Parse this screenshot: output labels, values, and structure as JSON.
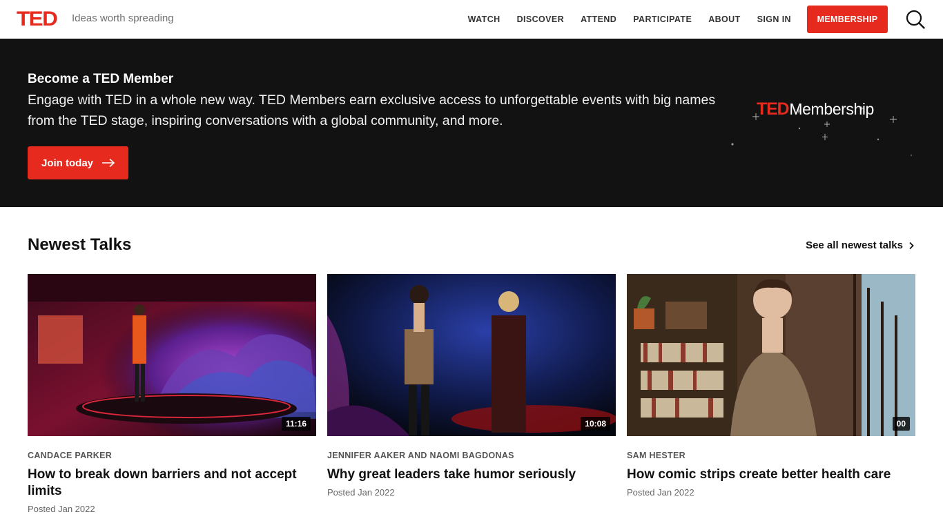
{
  "header": {
    "logo": "TED",
    "tagline": "Ideas worth spreading",
    "nav": [
      "WATCH",
      "DISCOVER",
      "ATTEND",
      "PARTICIPATE",
      "ABOUT",
      "SIGN IN"
    ],
    "membership_label": "MEMBERSHIP",
    "search_icon": "search-icon"
  },
  "banner": {
    "title": "Become a TED Member",
    "text": "Engage with TED in a whole new way. TED Members earn exclusive access to unforgettable events with big names from the TED stage, inspiring conversations with a global community, and more.",
    "join_label": "Join today",
    "logo_ted": "TED",
    "logo_word": "Membership"
  },
  "newest": {
    "title": "Newest Talks",
    "see_all": "See all newest talks",
    "talks": [
      {
        "speaker": "CANDACE PARKER",
        "title": "How to break down barriers and not accept limits",
        "posted": "Posted Jan 2022",
        "duration": "11:16"
      },
      {
        "speaker": "JENNIFER AAKER AND NAOMI BAGDONAS",
        "title": "Why great leaders take humor seriously",
        "posted": "Posted Jan 2022",
        "duration": "10:08"
      },
      {
        "speaker": "SAM HESTER",
        "title": "How comic strips create better health care",
        "posted": "Posted Jan 2022",
        "duration": "00"
      }
    ]
  },
  "colors": {
    "brand_red": "#e62b1e",
    "banner_bg": "#121212"
  }
}
